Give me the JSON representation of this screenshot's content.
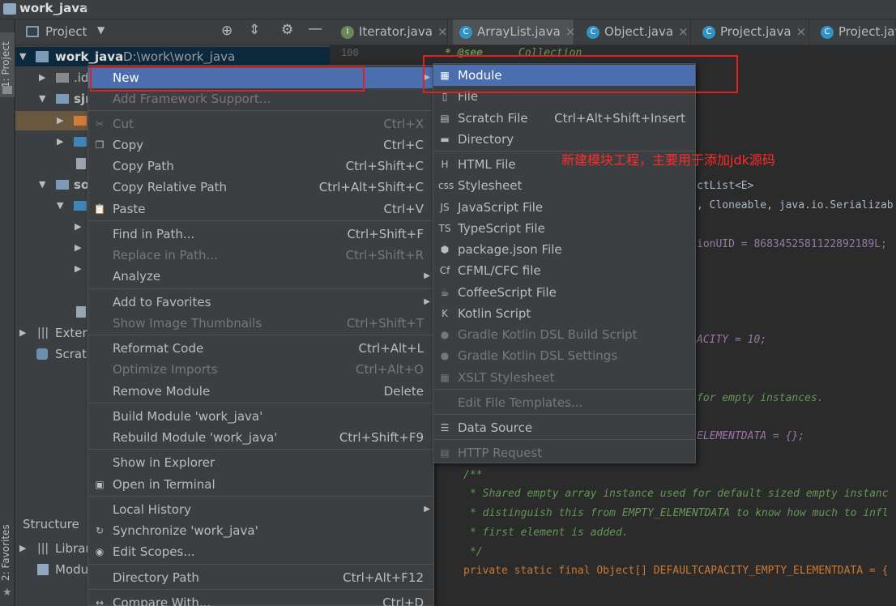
{
  "window": {
    "title": "work_java"
  },
  "left_strip": {
    "project_tab": "1: Project",
    "favorites_tab": "2: Favorites"
  },
  "project_panel": {
    "header_label": "Project",
    "root_name": "work_java",
    "root_path": "D:\\work\\work_java",
    "rows": [
      ".id",
      "sjr",
      "",
      "",
      "",
      "so",
      "",
      "",
      "",
      "",
      "",
      "Extern",
      "Scrato"
    ],
    "structure_label": "Structure",
    "bottom_rows": [
      "Librar",
      "Modu"
    ]
  },
  "tabs": [
    {
      "label": "Iterator.java",
      "icon": "I",
      "color": "#6a8759"
    },
    {
      "label": "ArrayList.java",
      "icon": "C",
      "color": "#3592c4"
    },
    {
      "label": "Object.java",
      "icon": "C",
      "color": "#3592c4"
    },
    {
      "label": "Project.java",
      "icon": "C",
      "color": "#3592c4"
    },
    {
      "label": "Project.jav",
      "icon": "C",
      "color": "#3592c4"
    }
  ],
  "editor": {
    "line_number": "100",
    "lines": {
      "see": "* @see",
      "collection": "Collection",
      "class_frag": "ctList<E>",
      "implements_frag": ", Cloneable, java.io.Serializab",
      "uid_frag": "ionUID = 8683452581122892189L;",
      "capacity_frag": "ACITY = 10;",
      "empty_frag": "for empty instances.",
      "elementdata_frag": "ELEMENTDATA = {};",
      "doc_open": "/**",
      "doc1": "* Shared empty array instance used for default sized empty instanc",
      "doc2": "* distinguish this from EMPTY_ELEMENTDATA to know how much to infl",
      "doc3": "* first element is added.",
      "doc_close": "*/",
      "decl": "private static final Object[] DEFAULTCAPACITY_EMPTY_ELEMENTDATA = {"
    }
  },
  "context_menu": {
    "items": [
      {
        "label": "New",
        "shortcut": "",
        "disabled": false,
        "highlight": true,
        "submenu": true
      },
      {
        "label": "Add Framework Support...",
        "shortcut": "",
        "disabled": true
      },
      {
        "label": "Cut",
        "shortcut": "Ctrl+X",
        "disabled": true,
        "icon": "scissors-icon"
      },
      {
        "label": "Copy",
        "shortcut": "Ctrl+C",
        "disabled": false,
        "icon": "copy-icon"
      },
      {
        "label": "Copy Path",
        "shortcut": "Ctrl+Shift+C",
        "disabled": false
      },
      {
        "label": "Copy Relative Path",
        "shortcut": "Ctrl+Alt+Shift+C",
        "disabled": false
      },
      {
        "label": "Paste",
        "shortcut": "Ctrl+V",
        "disabled": false,
        "icon": "paste-icon"
      },
      {
        "label": "Find in Path...",
        "shortcut": "Ctrl+Shift+F",
        "disabled": false
      },
      {
        "label": "Replace in Path...",
        "shortcut": "Ctrl+Shift+R",
        "disabled": true
      },
      {
        "label": "Analyze",
        "shortcut": "",
        "disabled": false,
        "submenu": true
      },
      {
        "label": "Add to Favorites",
        "shortcut": "",
        "disabled": false,
        "submenu": true
      },
      {
        "label": "Show Image Thumbnails",
        "shortcut": "Ctrl+Shift+T",
        "disabled": true
      },
      {
        "label": "Reformat Code",
        "shortcut": "Ctrl+Alt+L",
        "disabled": false
      },
      {
        "label": "Optimize Imports",
        "shortcut": "Ctrl+Alt+O",
        "disabled": true
      },
      {
        "label": "Remove Module",
        "shortcut": "Delete",
        "disabled": false
      },
      {
        "label": "Build Module 'work_java'",
        "shortcut": "",
        "disabled": false
      },
      {
        "label": "Rebuild Module 'work_java'",
        "shortcut": "Ctrl+Shift+F9",
        "disabled": false
      },
      {
        "label": "Show in Explorer",
        "shortcut": "",
        "disabled": false
      },
      {
        "label": "Open in Terminal",
        "shortcut": "",
        "disabled": false,
        "icon": "terminal-icon"
      },
      {
        "label": "Local History",
        "shortcut": "",
        "disabled": false,
        "submenu": true
      },
      {
        "label": "Synchronize 'work_java'",
        "shortcut": "",
        "disabled": false,
        "icon": "sync-icon"
      },
      {
        "label": "Edit Scopes...",
        "shortcut": "",
        "disabled": false,
        "icon": "scope-icon"
      },
      {
        "label": "Directory Path",
        "shortcut": "Ctrl+Alt+F12",
        "disabled": false
      },
      {
        "label": "Compare With...",
        "shortcut": "Ctrl+D",
        "disabled": false,
        "icon": "compare-icon"
      }
    ]
  },
  "submenu": {
    "items": [
      {
        "label": "Module",
        "shortcut": "",
        "disabled": false,
        "highlight": true,
        "icon": "module-icon"
      },
      {
        "label": "File",
        "shortcut": "",
        "disabled": false,
        "icon": "file-icon"
      },
      {
        "label": "Scratch File",
        "shortcut": "Ctrl+Alt+Shift+Insert",
        "disabled": false,
        "icon": "scratch-file-icon"
      },
      {
        "label": "Directory",
        "shortcut": "",
        "disabled": false,
        "icon": "folder-icon"
      },
      {
        "label": "HTML File",
        "shortcut": "",
        "disabled": false,
        "icon": "html-icon"
      },
      {
        "label": "Stylesheet",
        "shortcut": "",
        "disabled": false,
        "icon": "css-icon"
      },
      {
        "label": "JavaScript File",
        "shortcut": "",
        "disabled": false,
        "icon": "js-icon"
      },
      {
        "label": "TypeScript File",
        "shortcut": "",
        "disabled": false,
        "icon": "ts-icon"
      },
      {
        "label": "package.json File",
        "shortcut": "",
        "disabled": false,
        "icon": "nodejs-icon"
      },
      {
        "label": "CFML/CFC file",
        "shortcut": "",
        "disabled": false,
        "icon": "cf-icon"
      },
      {
        "label": "CoffeeScript File",
        "shortcut": "",
        "disabled": false,
        "icon": "coffee-icon"
      },
      {
        "label": "Kotlin Script",
        "shortcut": "",
        "disabled": false,
        "icon": "kotlin-icon"
      },
      {
        "label": "Gradle Kotlin DSL Build Script",
        "shortcut": "",
        "disabled": true,
        "icon": "gradle-icon"
      },
      {
        "label": "Gradle Kotlin DSL Settings",
        "shortcut": "",
        "disabled": true,
        "icon": "gradle-icon"
      },
      {
        "label": "XSLT Stylesheet",
        "shortcut": "",
        "disabled": true,
        "icon": "xslt-icon"
      },
      {
        "label": "Edit File Templates...",
        "shortcut": "",
        "disabled": true
      },
      {
        "label": "Data Source",
        "shortcut": "",
        "disabled": false,
        "icon": "database-icon"
      },
      {
        "label": "HTTP Request",
        "shortcut": "",
        "disabled": true,
        "icon": "http-icon"
      }
    ]
  },
  "annotation": {
    "text": "新建模块工程，主要用于添加jdk源码"
  }
}
